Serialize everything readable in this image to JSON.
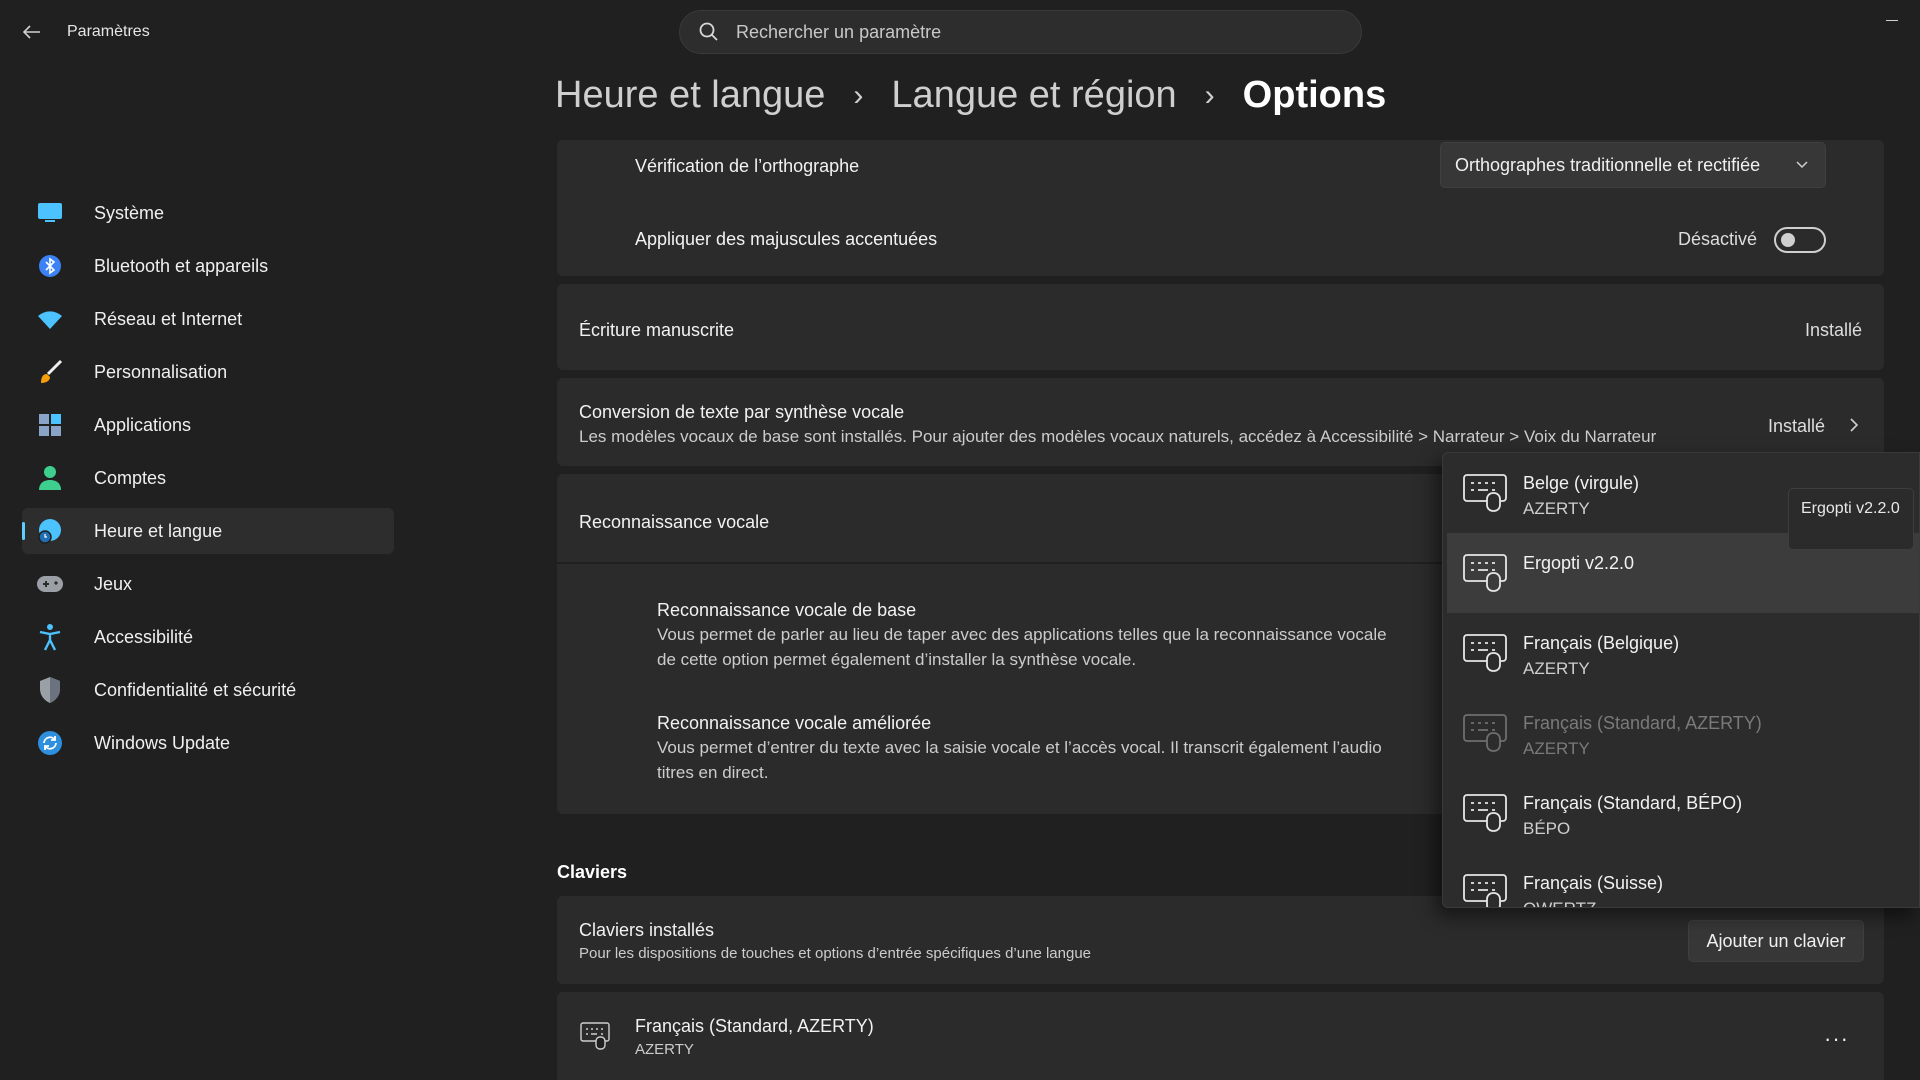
{
  "titlebar": {
    "app_title": "Paramètres"
  },
  "search": {
    "placeholder": "Rechercher un paramètre"
  },
  "sidebar": {
    "items": [
      {
        "label": "Système",
        "icon": "monitor-icon"
      },
      {
        "label": "Bluetooth et appareils",
        "icon": "bluetooth-icon"
      },
      {
        "label": "Réseau et Internet",
        "icon": "wifi-icon"
      },
      {
        "label": "Personnalisation",
        "icon": "brush-icon"
      },
      {
        "label": "Applications",
        "icon": "apps-icon"
      },
      {
        "label": "Comptes",
        "icon": "account-icon"
      },
      {
        "label": "Heure et langue",
        "icon": "globe-clock-icon",
        "active": true
      },
      {
        "label": "Jeux",
        "icon": "gamepad-icon"
      },
      {
        "label": "Accessibilité",
        "icon": "accessibility-icon"
      },
      {
        "label": "Confidentialité et sécurité",
        "icon": "shield-icon"
      },
      {
        "label": "Windows Update",
        "icon": "update-icon"
      }
    ]
  },
  "breadcrumb": {
    "item1": "Heure et langue",
    "item2": "Langue et région",
    "current": "Options"
  },
  "spelling": {
    "label": "Vérification de l’orthographe",
    "value": "Orthographes traditionnelle et rectifiée"
  },
  "accented_caps": {
    "label": "Appliquer des majuscules accentuées",
    "state": "Désactivé"
  },
  "handwriting": {
    "label": "Écriture manuscrite",
    "status": "Installé"
  },
  "tts": {
    "label": "Conversion de texte par synthèse vocale",
    "desc": "Les modèles vocaux de base sont installés. Pour ajouter des modèles vocaux naturels, accédez à Accessibilité > Narrateur > Voix du Narrateur",
    "status": "Installé"
  },
  "speech": {
    "label": "Reconnaissance vocale",
    "basic_title": "Reconnaissance vocale de base",
    "basic_desc1": "Vous permet de parler au lieu de taper avec des applications telles que la reconnaissance vocale",
    "basic_desc2": "de cette option permet également d’installer la synthèse vocale.",
    "enhanced_title": "Reconnaissance vocale améliorée",
    "enhanced_desc1": "Vous permet d’entrer du texte avec la saisie vocale et l’accès vocal. Il transcrit également l’audio",
    "enhanced_desc2": "titres en direct."
  },
  "keyboards": {
    "section": "Claviers",
    "installed_label": "Claviers installés",
    "installed_desc": "Pour les dispositions de touches et options d’entrée spécifiques d’une langue",
    "add_button": "Ajouter un clavier",
    "item_name": "Français (Standard, AZERTY)",
    "item_layout": "AZERTY",
    "more": "···"
  },
  "flyout": {
    "items": [
      {
        "name": "Belge (virgule)",
        "layout": "AZERTY"
      },
      {
        "name": "Ergopti v2.2.0",
        "layout": ""
      },
      {
        "name": "Français (Belgique)",
        "layout": "AZERTY"
      },
      {
        "name": "Français (Standard, AZERTY)",
        "layout": "AZERTY"
      },
      {
        "name": "Français (Standard, BÉPO)",
        "layout": "BÉPO"
      },
      {
        "name": "Français (Suisse)",
        "layout": "QWERTZ"
      }
    ],
    "tooltip": "Ergopti v2.2.0"
  }
}
